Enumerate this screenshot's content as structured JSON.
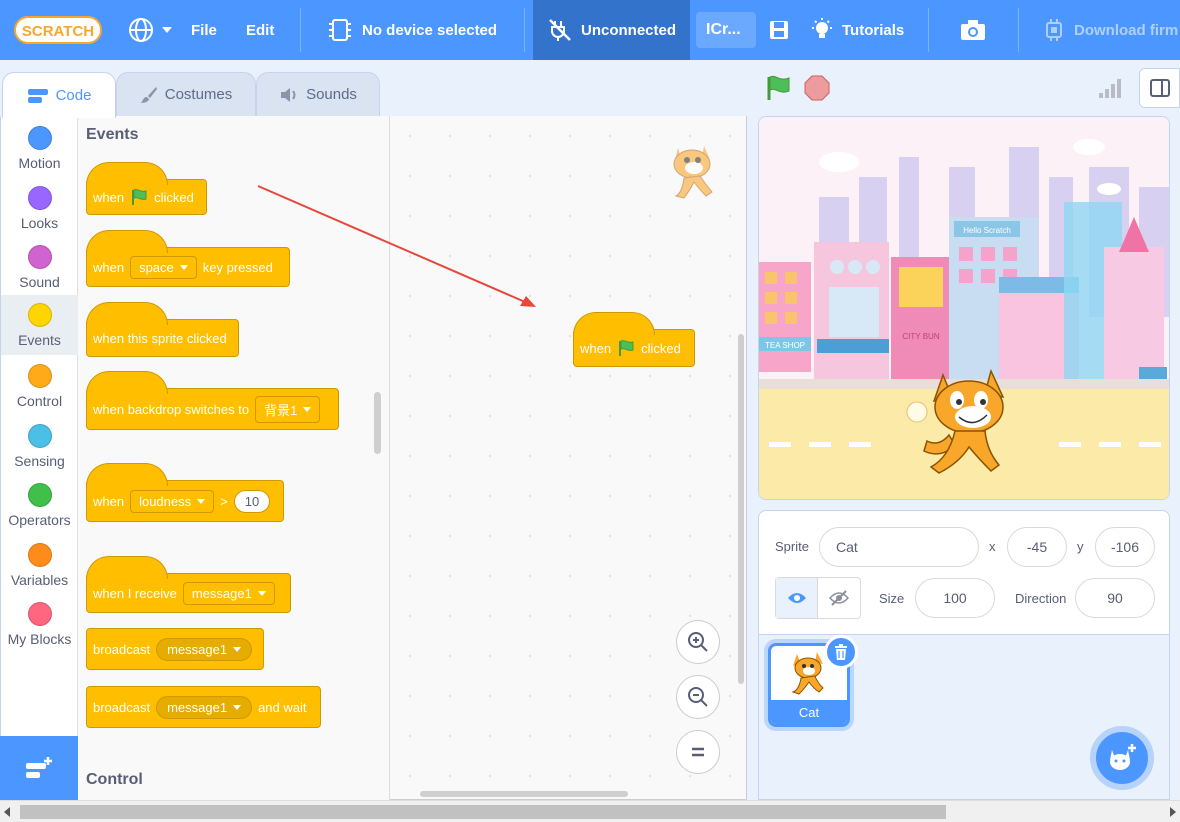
{
  "menu": {
    "logo_text": "SCRATCH",
    "file": "File",
    "edit": "Edit",
    "device": "No device selected",
    "connection": "Unconnected",
    "project_title": "ICr...",
    "tutorials": "Tutorials",
    "download": "Download firm"
  },
  "tabs": {
    "code": "Code",
    "costumes": "Costumes",
    "sounds": "Sounds"
  },
  "categories": [
    {
      "label": "Motion",
      "color": "#4c97ff"
    },
    {
      "label": "Looks",
      "color": "#9966ff"
    },
    {
      "label": "Sound",
      "color": "#cf63cf"
    },
    {
      "label": "Events",
      "color": "#ffd500"
    },
    {
      "label": "Control",
      "color": "#ffab19"
    },
    {
      "label": "Sensing",
      "color": "#4cbfe6"
    },
    {
      "label": "Operators",
      "color": "#40bf4a"
    },
    {
      "label": "Variables",
      "color": "#ff8c1a"
    },
    {
      "label": "My Blocks",
      "color": "#ff6680"
    }
  ],
  "palette": {
    "section_events": "Events",
    "section_control": "Control",
    "blocks": {
      "when_flag_when": "when",
      "when_flag_clicked": "clicked",
      "key_when": "when",
      "key_value": "space",
      "key_pressed": "key pressed",
      "sprite_clicked": "when this sprite clicked",
      "backdrop_text": "when backdrop switches to",
      "backdrop_value": "背景1",
      "loudness_when": "when",
      "loudness_value": "loudness",
      "loudness_op": ">",
      "loudness_num": "10",
      "receive_text": "when I receive",
      "receive_value": "message1",
      "broadcast_text": "broadcast",
      "broadcast_value": "message1",
      "broadcast_wait_text": "broadcast",
      "broadcast_wait_value": "message1",
      "broadcast_wait_suffix": "and wait"
    }
  },
  "workspace": {
    "block_when": "when",
    "block_clicked": "clicked"
  },
  "sprite": {
    "label_sprite": "Sprite",
    "name": "Cat",
    "label_x": "x",
    "x": "-45",
    "label_y": "y",
    "y": "-106",
    "label_size": "Size",
    "size": "100",
    "label_direction": "Direction",
    "direction": "90"
  },
  "sprite_list": [
    {
      "name": "Cat"
    }
  ],
  "stage_signs": {
    "tea_shop": "TEA SHOP",
    "city_bun": "CITY BUN",
    "hello_scratch": "Hello Scratch"
  },
  "colors": {
    "accent": "#4c97ff",
    "events": "#ffbf00",
    "arrow": "#e8473c"
  }
}
